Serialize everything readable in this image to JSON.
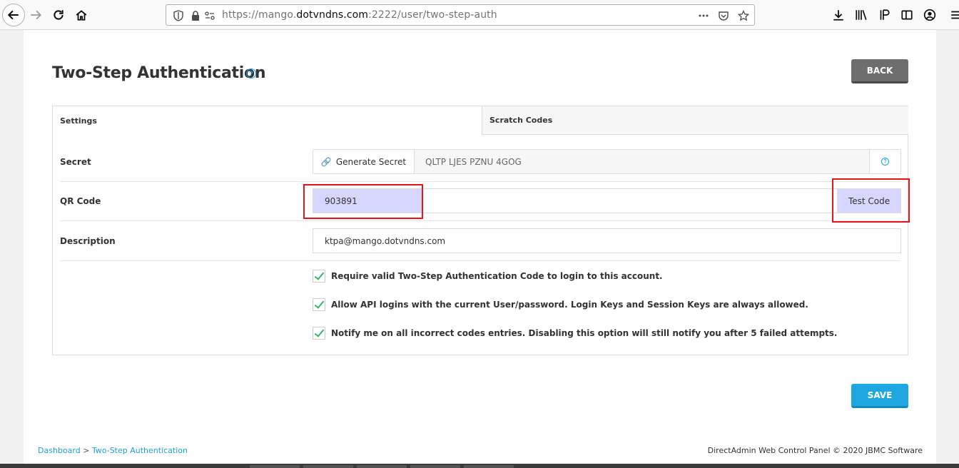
{
  "browser": {
    "url_prefix": "https://mango.",
    "url_host": "dotvndns.com",
    "url_suffix": ":2222/user/two-step-auth"
  },
  "page": {
    "title": "Two-Step Authentication",
    "back_label": "BACK",
    "tabs": [
      "Settings",
      "Scratch Codes"
    ],
    "secret_label": "Secret",
    "generate_label": "Generate Secret",
    "secret_value": "QLTP LJES PZNU 4GOG",
    "qr_label": "QR Code",
    "qr_value": "903891",
    "test_code_label": "Test Code",
    "description_label": "Description",
    "description_value": "ktpa@mango.dotvndns.com",
    "options": [
      "Require valid Two-Step Authentication Code to login to this account.",
      "Allow API logins with the current User/password. Login Keys and Session Keys are always allowed.",
      "Notify me on all incorrect codes entries. Disabling this option will still notify you after 5 failed attempts."
    ],
    "save_label": "SAVE",
    "breadcrumb_home": "Dashboard",
    "breadcrumb_sep": ">",
    "breadcrumb_current": "Two-Step Authentication",
    "footer": "DirectAdmin Web Control Panel © 2020 JBMC Software"
  },
  "colors": {
    "accent": "#1e9fd8",
    "highlight": "#e8141c",
    "selected_fill": "#d6d6ff"
  }
}
